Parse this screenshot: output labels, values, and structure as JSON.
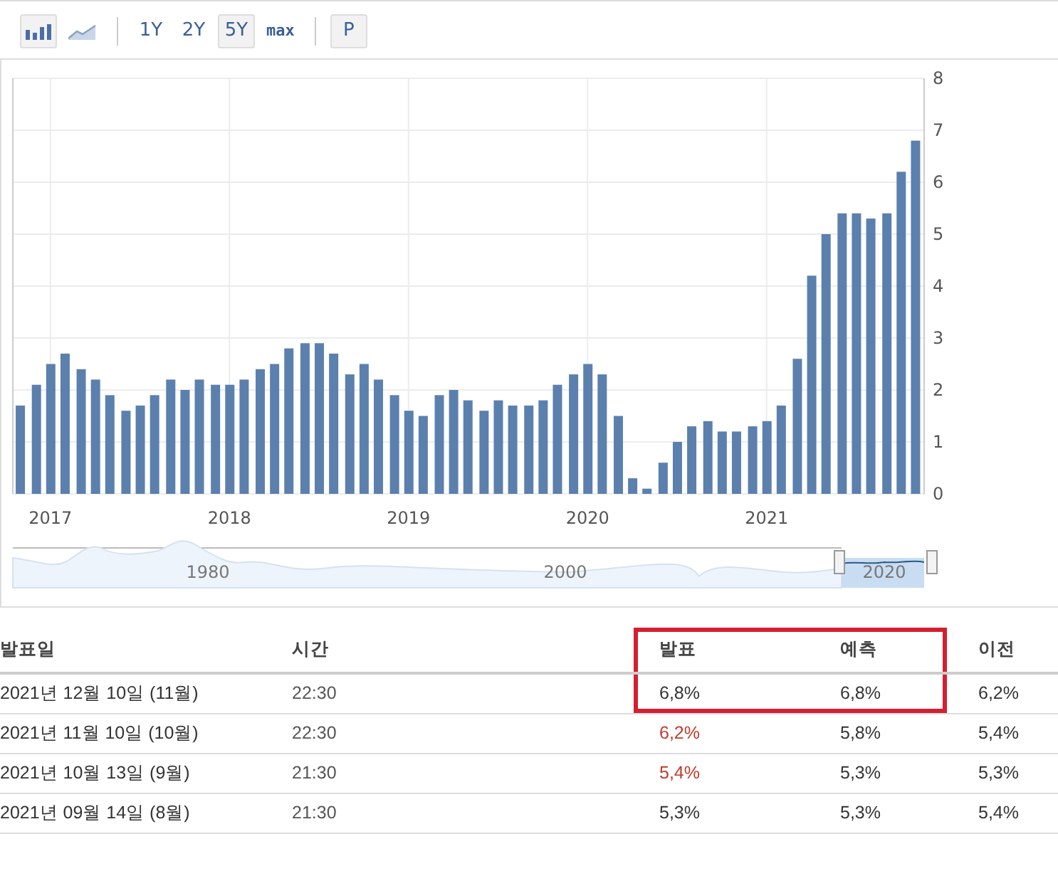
{
  "toolbar": {
    "chart_types": [
      {
        "kind": "bar",
        "selected": true
      },
      {
        "kind": "line",
        "selected": false
      }
    ],
    "ranges": [
      {
        "label": "1Y",
        "selected": false
      },
      {
        "label": "2Y",
        "selected": false
      },
      {
        "label": "5Y",
        "selected": true
      },
      {
        "label": "max",
        "selected": false
      }
    ],
    "extra": [
      "P"
    ]
  },
  "chart": {
    "chart_data": {
      "type": "bar",
      "grid": true,
      "x": [
        2016.83,
        2016.92,
        2017.0,
        2017.08,
        2017.17,
        2017.25,
        2017.33,
        2017.42,
        2017.5,
        2017.58,
        2017.67,
        2017.75,
        2017.83,
        2017.92,
        2018.0,
        2018.08,
        2018.17,
        2018.25,
        2018.33,
        2018.42,
        2018.5,
        2018.58,
        2018.67,
        2018.75,
        2018.83,
        2018.92,
        2019.0,
        2019.08,
        2019.17,
        2019.25,
        2019.33,
        2019.42,
        2019.5,
        2019.58,
        2019.67,
        2019.75,
        2019.83,
        2019.92,
        2020.0,
        2020.08,
        2020.17,
        2020.25,
        2020.33,
        2020.42,
        2020.5,
        2020.58,
        2020.67,
        2020.75,
        2020.83,
        2020.92,
        2021.0,
        2021.08,
        2021.17,
        2021.25,
        2021.33,
        2021.42,
        2021.5,
        2021.58,
        2021.67,
        2021.75,
        2021.83
      ],
      "xlim": [
        2016.79,
        2021.88
      ],
      "values": [
        1.7,
        2.1,
        2.5,
        2.7,
        2.4,
        2.2,
        1.9,
        1.6,
        1.7,
        1.9,
        2.2,
        2.0,
        2.2,
        2.1,
        2.1,
        2.2,
        2.4,
        2.5,
        2.8,
        2.9,
        2.9,
        2.7,
        2.3,
        2.5,
        2.2,
        1.9,
        1.6,
        1.5,
        1.9,
        2.0,
        1.8,
        1.6,
        1.8,
        1.7,
        1.7,
        1.8,
        2.1,
        2.3,
        2.5,
        2.3,
        1.5,
        0.3,
        0.1,
        0.6,
        1.0,
        1.3,
        1.4,
        1.2,
        1.2,
        1.3,
        1.4,
        1.7,
        2.6,
        4.2,
        5.0,
        5.4,
        5.4,
        5.3,
        5.4,
        6.2,
        6.8
      ],
      "ylim": [
        0,
        8
      ],
      "yticks": [
        0,
        1,
        2,
        3,
        4,
        5,
        6,
        7,
        8
      ],
      "xticks": [
        2017,
        2018,
        2019,
        2020,
        2021
      ]
    }
  },
  "navigator": {
    "labels": [
      "1980",
      "2000",
      "2020"
    ]
  },
  "table": {
    "columns": [
      {
        "label": "발표일",
        "highlighted": false
      },
      {
        "label": "시간",
        "highlighted": false
      },
      {
        "label": "발표",
        "highlighted": true
      },
      {
        "label": "예측",
        "highlighted": true
      },
      {
        "label": "이전",
        "highlighted": false
      }
    ],
    "rows": [
      {
        "highlighted": true,
        "date": "2021년 12월 10일 (11월)",
        "time": "22:30",
        "actual": {
          "text": "6,8%",
          "color": "#333333"
        },
        "forecast": "6,8%",
        "previous": "6,2%"
      },
      {
        "highlighted": false,
        "date": "2021년 11월 10일 (10월)",
        "time": "22:30",
        "actual": {
          "text": "6,2%",
          "color": "#c0392b"
        },
        "forecast": "5,8%",
        "previous": "5,4%"
      },
      {
        "highlighted": false,
        "date": "2021년 10월 13일 (9월)",
        "time": "21:30",
        "actual": {
          "text": "5,4%",
          "color": "#c0392b"
        },
        "forecast": "5,3%",
        "previous": "5,3%"
      },
      {
        "highlighted": false,
        "date": "2021년 09월 14일 (8월)",
        "time": "21:30",
        "actual": {
          "text": "5,3%",
          "color": "#333333"
        },
        "forecast": "5,3%",
        "previous": "5,4%"
      }
    ]
  }
}
